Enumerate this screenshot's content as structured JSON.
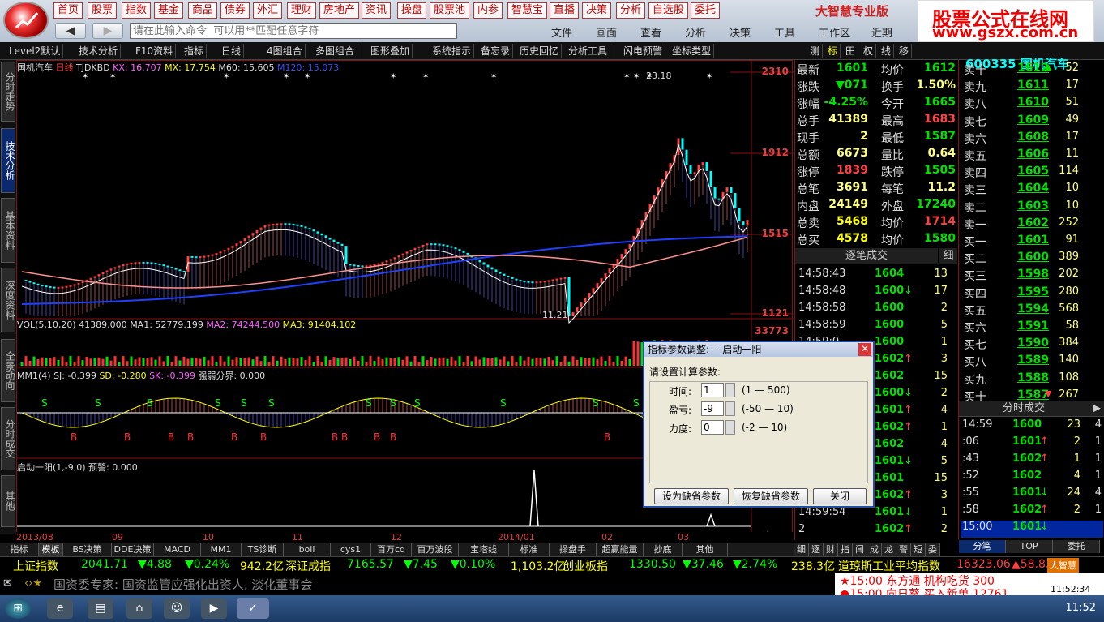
{
  "menu": [
    "首页",
    "股票",
    "指数",
    "基金",
    "商品",
    "债券",
    "外汇",
    "理财",
    "房地产",
    "资讯",
    "操盘",
    "股票池",
    "内参",
    "智慧宝",
    "直播",
    "决策",
    "分析",
    "自选股",
    "委托"
  ],
  "brand": "大智慧专业版",
  "watermark": {
    "line1": "股票公式在线网",
    "line2": "www.gszx.com.cn"
  },
  "command": {
    "placeholder": "请在此输入命令  可以用**匹配任意字符"
  },
  "right_menu": [
    "文件",
    "画面",
    "查看",
    "分析",
    "决策",
    "工具",
    "工作区",
    "近期"
  ],
  "toolbar": [
    "Level2默认",
    "技术分析",
    "F10资料",
    "指标",
    "日线",
    "4图组合",
    "多图组合",
    "图形叠加",
    "系统指示",
    "备忘录",
    "历史回忆",
    "分析工具",
    "闪电预警",
    "坐标类型"
  ],
  "toolbar_right": [
    "测",
    "标",
    "田",
    "权",
    "线",
    "移"
  ],
  "left_tabs": [
    "分时走势",
    "技术分析",
    "基本资料",
    "深度资料",
    "全景动向",
    "分时成交",
    "其他"
  ],
  "stock": {
    "name": "国机汽车",
    "code": "600335",
    "period": "日线"
  },
  "ind_main": {
    "name": "TJDKBD",
    "kx": "KX: 16.707",
    "mx": "MX: 17.754",
    "m60": "M60: 15.605",
    "m120": "M120: 15.073"
  },
  "ind_vol": {
    "name": "VOL(5,10,20)",
    "v": "41389.000",
    "ma1": "MA1: 52779.199",
    "ma2": "MA2: 74244.500",
    "ma3": "MA3: 91404.102"
  },
  "ind_mm1": {
    "name": "MM1(4)",
    "sj": "SJ: -0.399",
    "sd": "SD: -0.280",
    "sk": "SK: -0.399",
    "qr": "强弱分界: 0.000"
  },
  "ind_qd": {
    "name": "启动一阳(1,-9,0)",
    "yj": "预警: 0.000"
  },
  "price_tags": {
    "p1": "2310",
    "p2": "1912",
    "p3": "1515",
    "p4": "1121",
    "vol": "33773",
    "hi": "23.18",
    "lo": "11.21"
  },
  "xaxis": [
    "2013/08",
    "09",
    "10",
    "11",
    "12",
    "2014/01",
    "02",
    "03"
  ],
  "bottom_tabs": [
    "指标",
    "模板",
    "BS决策",
    "DDE决策",
    "MACD",
    "MM1",
    "TS诊断",
    "boll",
    "cys1",
    "百万cd",
    "百万波段",
    "宝塔线",
    "标准",
    "操盘手",
    "超赢能量",
    "抄底",
    "其他"
  ],
  "bottom_right_tabs": [
    "细",
    "逐",
    "财",
    "指",
    "闻",
    "成",
    "龙",
    "警",
    "短",
    "委"
  ],
  "daily_label": "日线",
  "quote": [
    {
      "l1": "最新",
      "v1": "1601",
      "l2": "均价",
      "v2": "1612"
    },
    {
      "l1": "涨跌",
      "v1": "▼071",
      "l2": "换手",
      "v2": "1.50%"
    },
    {
      "l1": "涨幅",
      "v1": "-4.25%",
      "l2": "今开",
      "v2": "1665"
    },
    {
      "l1": "总手",
      "v1": "41389",
      "l2": "最高",
      "v2": "1683"
    },
    {
      "l1": "现手",
      "v1": "2",
      "l2": "最低",
      "v2": "1587"
    },
    {
      "l1": "总额",
      "v1": "6673",
      "l2": "量比",
      "v2": "0.64"
    },
    {
      "l1": "涨停",
      "v1": "1839",
      "l2": "跌停",
      "v2": "1505"
    },
    {
      "l1": "总笔",
      "v1": "3691",
      "l2": "每笔",
      "v2": "11.2"
    },
    {
      "l1": "内盘",
      "v1": "24149",
      "l2": "外盘",
      "v2": "17240"
    },
    {
      "l1": "总卖",
      "v1": "5468",
      "l2": "均价",
      "v2": "1714"
    },
    {
      "l1": "总买",
      "v1": "4578",
      "l2": "均价",
      "v2": "1580"
    }
  ],
  "ticks_title": "逐笔成交",
  "ticks_btn": "细",
  "ticks": [
    {
      "t": "14:58:43",
      "p": "1604",
      "a": "",
      "v": "13"
    },
    {
      "t": "14:58:48",
      "p": "1600",
      "a": "↓",
      "v": "17"
    },
    {
      "t": "14:58:58",
      "p": "1600",
      "a": "",
      "v": "2"
    },
    {
      "t": "14:58:59",
      "p": "1600",
      "a": "",
      "v": "5"
    },
    {
      "t": "14:59:0",
      "p": "1600",
      "a": "",
      "v": "1"
    },
    {
      "t": "14:59:1",
      "p": "1602",
      "a": "↑",
      "v": "3"
    },
    {
      "t": "14:59:6",
      "p": "1602",
      "a": "",
      "v": "15"
    },
    {
      "t": "14:59:9",
      "p": "1600",
      "a": "↓",
      "v": "2"
    },
    {
      "t": "14:59:12",
      "p": "1601",
      "a": "↑",
      "v": "4"
    },
    {
      "t": "14:59:23",
      "p": "1602",
      "a": "↑",
      "v": "1"
    },
    {
      "t": "14:59:30",
      "p": "1602",
      "a": "",
      "v": "4"
    },
    {
      "t": "14:59:37",
      "p": "1601",
      "a": "↓",
      "v": "5"
    },
    {
      "t": "14:59:41",
      "p": "1601",
      "a": "",
      "v": "15"
    },
    {
      "t": "14:59:48",
      "p": "1602",
      "a": "↑",
      "v": "3"
    },
    {
      "t": "14:59:54",
      "p": "1601",
      "a": "↓",
      "v": "1"
    },
    {
      "t": "2",
      "p": "1602",
      "a": "↑",
      "v": "2"
    }
  ],
  "orderbook": [
    {
      "l": "卖十",
      "p": "1612",
      "a": "▲",
      "v": "52"
    },
    {
      "l": "卖九",
      "p": "1611",
      "a": "",
      "v": "17"
    },
    {
      "l": "卖八",
      "p": "1610",
      "a": "",
      "v": "51"
    },
    {
      "l": "卖七",
      "p": "1609",
      "a": "",
      "v": "49"
    },
    {
      "l": "卖六",
      "p": "1608",
      "a": "",
      "v": "17"
    },
    {
      "l": "卖五",
      "p": "1606",
      "a": "",
      "v": "11"
    },
    {
      "l": "卖四",
      "p": "1605",
      "a": "",
      "v": "114"
    },
    {
      "l": "卖三",
      "p": "1604",
      "a": "",
      "v": "10"
    },
    {
      "l": "卖二",
      "p": "1603",
      "a": "",
      "v": "10"
    },
    {
      "l": "卖一",
      "p": "1602",
      "a": "",
      "v": "252"
    },
    {
      "l": "买一",
      "p": "1601",
      "a": "",
      "v": "91"
    },
    {
      "l": "买二",
      "p": "1600",
      "a": "",
      "v": "389"
    },
    {
      "l": "买三",
      "p": "1598",
      "a": "",
      "v": "202"
    },
    {
      "l": "买四",
      "p": "1595",
      "a": "",
      "v": "280"
    },
    {
      "l": "买五",
      "p": "1594",
      "a": "",
      "v": "568"
    },
    {
      "l": "买六",
      "p": "1591",
      "a": "",
      "v": "58"
    },
    {
      "l": "买七",
      "p": "1590",
      "a": "",
      "v": "384"
    },
    {
      "l": "买八",
      "p": "1589",
      "a": "",
      "v": "140"
    },
    {
      "l": "买九",
      "p": "1588",
      "a": "",
      "v": "108"
    },
    {
      "l": "买十",
      "p": "1587",
      "a": "▼",
      "v": "267"
    }
  ],
  "minute_title": "分时成交",
  "minute": [
    {
      "t": "14:59",
      "p": "1600",
      "a": "",
      "v": "23",
      "n": "4"
    },
    {
      "t": ":06",
      "p": "1601",
      "a": "↑",
      "v": "2",
      "n": "1"
    },
    {
      "t": ":43",
      "p": "1602",
      "a": "↑",
      "v": "1",
      "n": "1"
    },
    {
      "t": ":52",
      "p": "1602",
      "a": "",
      "v": "4",
      "n": "1"
    },
    {
      "t": ":55",
      "p": "1601",
      "a": "↓",
      "v": "24",
      "n": "4"
    },
    {
      "t": ":58",
      "p": "1602",
      "a": "↑",
      "v": "2",
      "n": "1"
    },
    {
      "t": "15:00",
      "p": "1601",
      "a": "↓",
      "v": "",
      "n": ""
    }
  ],
  "right_bottom_tabs": [
    "分笔",
    "TOP",
    "委托"
  ],
  "dialog": {
    "title": "指标参数调整: -- 启动一阳",
    "prompt": "请设置计算参数:",
    "params": [
      {
        "label": "时间:",
        "value": "1",
        "range": "(1 — 500)"
      },
      {
        "label": "盈亏:",
        "value": "-9",
        "range": "(-50 — 10)"
      },
      {
        "label": "力度:",
        "value": "0",
        "range": "(-2 — 10)"
      }
    ],
    "btn_default": "设为缺省参数",
    "btn_restore": "恢复缺省参数",
    "btn_close": "关闭"
  },
  "status": [
    {
      "t": "上证指数",
      "c": "#ffff00"
    },
    {
      "t": "2041.71",
      "c": "#00ff00"
    },
    {
      "t": "▼4.88",
      "c": "#00ff00"
    },
    {
      "t": "▼0.24%",
      "c": "#00ff00"
    },
    {
      "t": "942.2亿",
      "c": "#ffff00"
    },
    {
      "t": "深证成指",
      "c": "#ffff00"
    },
    {
      "t": "7165.57",
      "c": "#00ff00"
    },
    {
      "t": "▼7.45",
      "c": "#00ff00"
    },
    {
      "t": "▼0.10%",
      "c": "#00ff00"
    },
    {
      "t": "1,103.2亿",
      "c": "#ffff00"
    },
    {
      "t": "创业板指",
      "c": "#ffff00"
    },
    {
      "t": "1330.50",
      "c": "#00ff00"
    },
    {
      "t": "▼37.46",
      "c": "#00ff00"
    },
    {
      "t": "▼2.74%",
      "c": "#00ff00"
    },
    {
      "t": "238.3亿",
      "c": "#ffff00"
    },
    {
      "t": "道琼斯工业平均指数",
      "c": "#ffff00"
    },
    {
      "t": "16323.06",
      "c": "#ff4040"
    },
    {
      "t": "▲58.83",
      "c": "#ff4040"
    }
  ],
  "news": "国资委专家: 国资监管应强化出资人, 淡化董事会",
  "news_right": {
    "l1": "★15:00 东方通  机构吃货 300",
    "l2": "●15:00 向日葵  买入新单 12761",
    "logo": "大智慧"
  },
  "clock": {
    "time": "11:52",
    "small": "11:52:34"
  },
  "colors": {
    "up": "#ff3030",
    "down": "#00e000",
    "yellow": "#ffff00",
    "label": "#d0d0d0",
    "cyan": "#00ffff"
  }
}
